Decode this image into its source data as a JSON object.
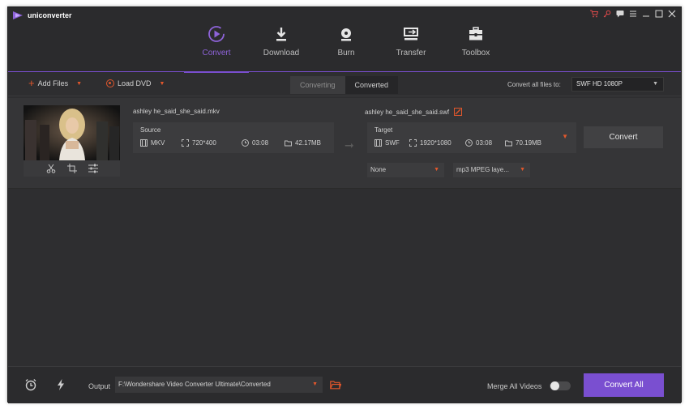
{
  "app": {
    "title": "uniconverter"
  },
  "nav": [
    {
      "label": "Convert",
      "icon": "convert-icon",
      "active": true
    },
    {
      "label": "Download",
      "icon": "download-icon",
      "active": false
    },
    {
      "label": "Burn",
      "icon": "burn-icon",
      "active": false
    },
    {
      "label": "Transfer",
      "icon": "transfer-icon",
      "active": false
    },
    {
      "label": "Toolbox",
      "icon": "toolbox-icon",
      "active": false
    }
  ],
  "toolbar": {
    "add_files": "Add Files",
    "load_dvd": "Load DVD",
    "tab_converting": "Converting",
    "tab_converted": "Converted",
    "convert_all_to_label": "Convert all files to:",
    "format_value": "SWF HD 1080P"
  },
  "file": {
    "source_name": "ashley he_said_she_said.mkv",
    "source_title": "Source",
    "source_format": "MKV",
    "source_resolution": "720*400",
    "source_duration": "03:08",
    "source_size": "42.17MB",
    "target_name": "ashley he_said_she_said.swf",
    "target_title": "Target",
    "target_format": "SWF",
    "target_resolution": "1920*1080",
    "target_duration": "03:08",
    "target_size": "70.19MB",
    "convert_label": "Convert",
    "subtitle_value": "None",
    "audio_value": "mp3 MPEG laye..."
  },
  "footer": {
    "output_label": "Output",
    "output_path": "F:\\Wondershare Video Converter Ultimate\\Converted",
    "merge_label": "Merge All Videos",
    "merge_enabled": false,
    "convert_all_label": "Convert All"
  },
  "colors": {
    "accent": "#7a4fd0",
    "orange": "#e2572c",
    "window_bg": "#2e2e30"
  }
}
